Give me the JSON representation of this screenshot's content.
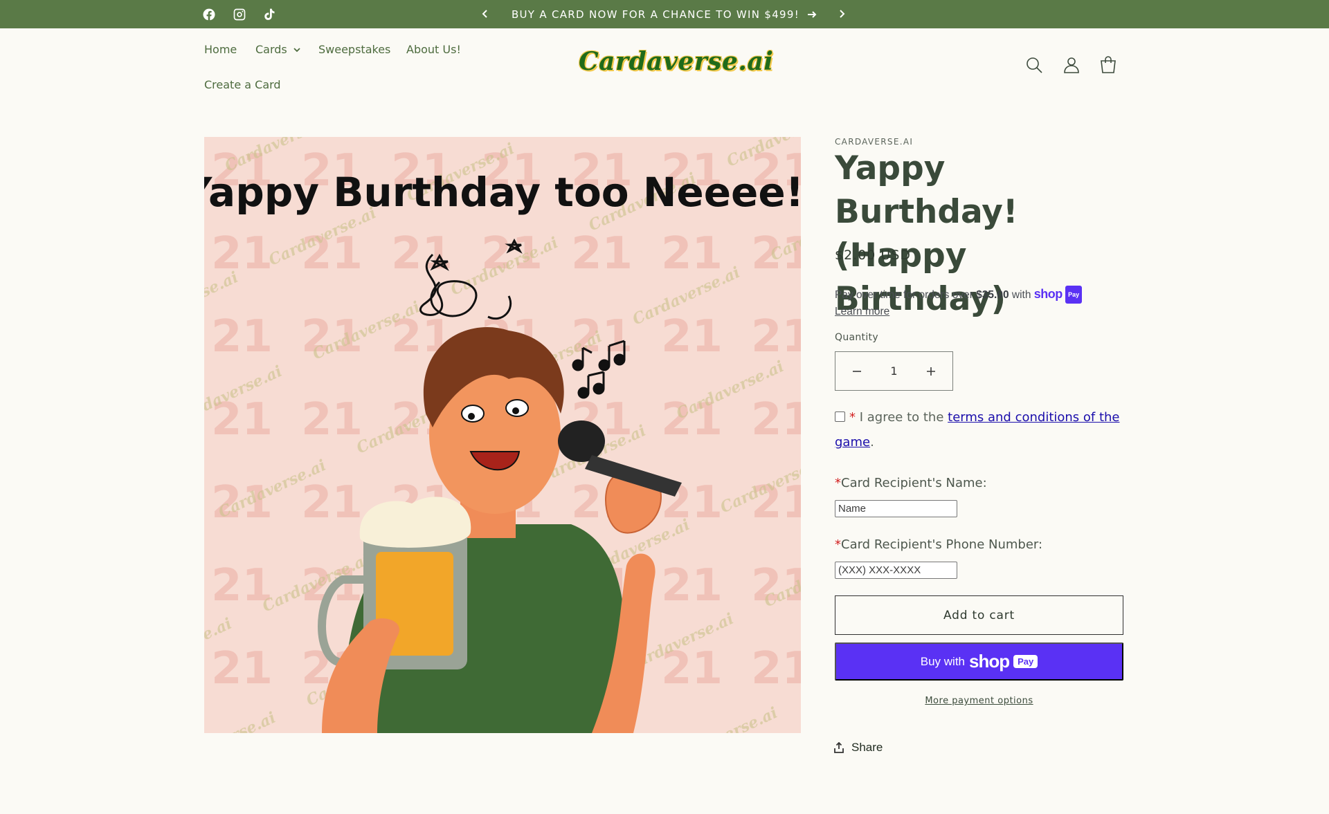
{
  "announcement": {
    "text": "BUY A CARD NOW FOR A CHANCE TO WIN $499!",
    "social": [
      "facebook-icon",
      "instagram-icon",
      "tiktok-icon"
    ]
  },
  "nav": {
    "items": [
      "Home",
      "Cards",
      "Sweepstakes",
      "About Us!",
      "Create a Card"
    ]
  },
  "logo": {
    "text": "Cardaverse.ai"
  },
  "product": {
    "image": {
      "headline": "Yappy Burthday too Neeee!!",
      "watermark": "Cardaverse.ai",
      "pattern_number": "21"
    },
    "vendor": "CARDAVERSE.AI",
    "title": "Yappy Burthday! (Happy Birthday)",
    "price": "$2.00 USD",
    "installments": {
      "prefix": "Pay over time for orders over ",
      "amount": "$35.00",
      "suffix": " with ",
      "brand": "shop",
      "brand_pill": "Pay",
      "learn_more": "Learn more"
    },
    "quantity_label": "Quantity",
    "quantity_value": "1",
    "agree": {
      "star": "*",
      "text": " I agree to the ",
      "link": "terms and conditions of the game",
      "end": "."
    },
    "recipient_name_label": "Card Recipient's Name:",
    "recipient_name_placeholder": "Name",
    "recipient_phone_label": "Card Recipient's Phone Number:",
    "recipient_phone_placeholder": "(XXX) XXX-XXXX",
    "add_to_cart": "Add to cart",
    "buy_with": "Buy with",
    "buy_brand": "shop",
    "buy_pill": "Pay",
    "more_payment": "More payment options",
    "share": "Share"
  },
  "colors": {
    "announce_bg": "#5a7a47",
    "page_bg": "#fbfaf5",
    "shop_pay": "#5a31f4",
    "required_star": "#d21f1f"
  }
}
